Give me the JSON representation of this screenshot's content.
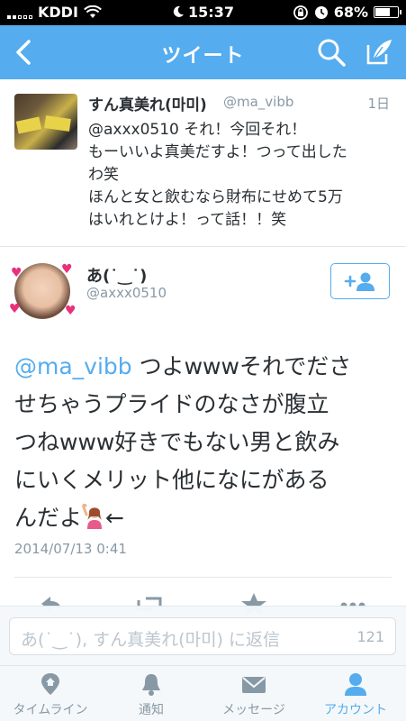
{
  "status_bar": {
    "carrier": "KDDI",
    "time": "15:37",
    "battery": "68%",
    "battery_level": 0.68
  },
  "nav": {
    "title": "ツイート"
  },
  "parent_tweet": {
    "name": "すん真美れ(마미)",
    "handle": "@ma_vibb",
    "time": "1日",
    "lines": [
      "@axxx0510 それ！今回それ！",
      "もーいいよ真美だすよ！つって出した",
      "わ笑",
      "ほんと女と飲むなら財布にせめて5万",
      "はいれとけよ！って話！！笑"
    ]
  },
  "tweet": {
    "name": "あ(˙‿˙)",
    "handle": "@axxx0510",
    "mention": "@ma_vibb",
    "line1_rest": " つよwwwそれでださ",
    "line2": "せちゃうプライドのなさが腹立",
    "line3": "つねwww好きでもない男と飲み",
    "line4": "にいくメリット他になにがある",
    "line5_a": "んだよ",
    "line5_b": "←",
    "date": "2014/07/13 0:41"
  },
  "reply": {
    "placeholder": "あ(˙‿˙), すん真美れ(마미) に返信",
    "count": "121"
  },
  "tabs": [
    {
      "label": "タイムライン",
      "icon": "home-icon",
      "active": false
    },
    {
      "label": "通知",
      "icon": "bell-icon",
      "active": false
    },
    {
      "label": "メッセージ",
      "icon": "envelope-icon",
      "active": false
    },
    {
      "label": "アカウント",
      "icon": "person-icon",
      "active": true
    }
  ],
  "colors": {
    "accent": "#55acee",
    "text": "#292f33",
    "muted": "#8899a6"
  }
}
